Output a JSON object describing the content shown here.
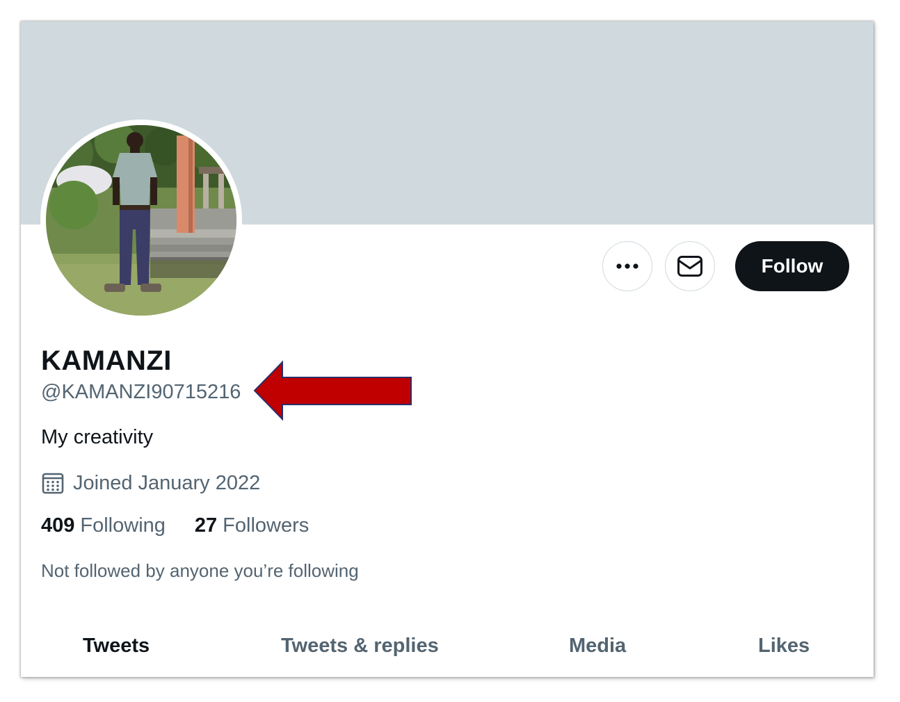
{
  "profile": {
    "display_name": "KAMANZI",
    "handle": "@KAMANZI90715216",
    "bio": "My creativity",
    "joined": "Joined January 2022",
    "following_count": "409",
    "following_label": "Following",
    "followers_count": "27",
    "followers_label": "Followers",
    "mutuals_note": "Not followed by anyone you’re following"
  },
  "actions": {
    "more_icon": "more-horizontal-icon",
    "message_icon": "envelope-icon",
    "follow_label": "Follow"
  },
  "tabs": [
    {
      "label": "Tweets",
      "active": true
    },
    {
      "label": "Tweets & replies",
      "active": false
    },
    {
      "label": "Media",
      "active": false
    },
    {
      "label": "Likes",
      "active": false
    }
  ],
  "colors": {
    "banner": "#cfd9de",
    "primary_text": "#0f1419",
    "secondary_text": "#536471",
    "follow_button": "#0f1419",
    "annotation_arrow": "#c00000"
  }
}
